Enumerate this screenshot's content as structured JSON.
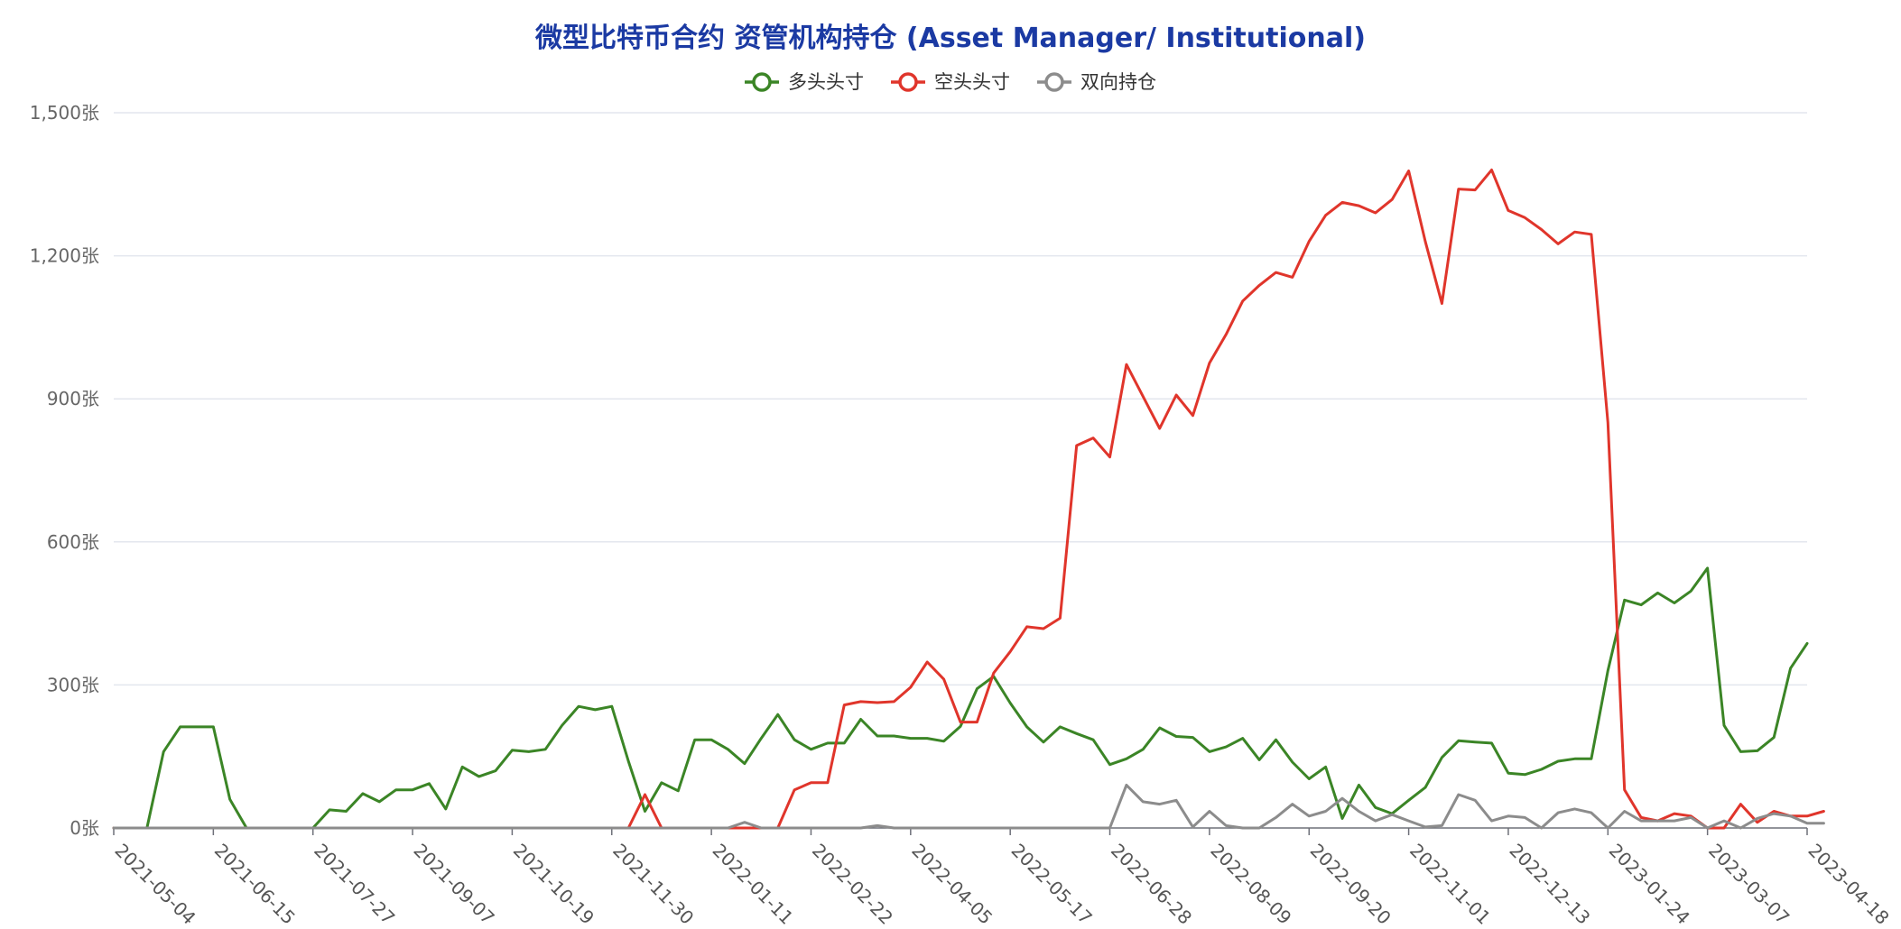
{
  "chart_data": {
    "type": "line",
    "title": "微型比特币合约 资管机构持仓 (Asset Manager/ Institutional)",
    "unit": "张",
    "ylim": [
      0,
      1500
    ],
    "yticks": [
      "0张",
      "300张",
      "600张",
      "900张",
      "1,200张",
      "1,500张"
    ],
    "ytick_values": [
      0,
      300,
      600,
      900,
      1200,
      1500
    ],
    "x_labels": [
      "2021-05-04",
      "2021-06-15",
      "2021-07-27",
      "2021-09-07",
      "2021-10-19",
      "2021-11-30",
      "2022-01-11",
      "2022-02-22",
      "2022-04-05",
      "2022-05-17",
      "2022-06-28",
      "2022-08-09",
      "2022-09-20",
      "2022-11-01",
      "2022-12-13",
      "2023-01-24",
      "2023-03-07",
      "2023-04-18"
    ],
    "x_label_step": 6,
    "grid": true,
    "legend_position": "top-center",
    "series": [
      {
        "name": "多头头寸",
        "color": "#3b8526",
        "values": [
          0,
          0,
          0,
          160,
          212,
          212,
          212,
          60,
          0,
          0,
          0,
          0,
          0,
          38,
          35,
          72,
          55,
          80,
          80,
          93,
          40,
          128,
          108,
          120,
          163,
          160,
          165,
          215,
          255,
          248,
          255,
          140,
          35,
          95,
          78,
          185,
          185,
          165,
          135,
          188,
          238,
          185,
          165,
          178,
          178,
          228,
          193,
          193,
          188,
          188,
          182,
          213,
          292,
          318,
          262,
          212,
          180,
          212,
          198,
          185,
          133,
          145,
          165,
          210,
          192,
          190,
          160,
          170,
          188,
          143,
          185,
          138,
          103,
          128,
          20,
          90,
          43,
          30,
          58,
          85,
          148,
          183,
          180,
          178,
          115,
          112,
          123,
          140,
          145,
          145,
          330,
          478,
          468,
          493,
          472,
          497,
          545,
          215,
          160,
          162,
          190,
          335,
          387
        ]
      },
      {
        "name": "空头头寸",
        "color": "#e0352b",
        "values": [
          0,
          0,
          0,
          0,
          0,
          0,
          0,
          0,
          0,
          0,
          0,
          0,
          0,
          0,
          0,
          0,
          0,
          0,
          0,
          0,
          0,
          0,
          0,
          0,
          0,
          0,
          0,
          0,
          0,
          0,
          0,
          0,
          70,
          0,
          0,
          0,
          0,
          0,
          0,
          0,
          0,
          80,
          95,
          95,
          258,
          265,
          263,
          265,
          295,
          348,
          312,
          222,
          222,
          325,
          370,
          422,
          418,
          440,
          802,
          818,
          778,
          972,
          905,
          838,
          908,
          865,
          975,
          1035,
          1105,
          1138,
          1165,
          1155,
          1230,
          1285,
          1312,
          1305,
          1290,
          1318,
          1378,
          1230,
          1100,
          1340,
          1338,
          1380,
          1295,
          1280,
          1255,
          1225,
          1250,
          1245,
          850,
          80,
          22,
          15,
          30,
          25,
          0,
          0,
          50,
          12,
          35,
          25,
          25,
          35
        ]
      },
      {
        "name": "双向持仓",
        "color": "#8c8c8c",
        "values": [
          0,
          0,
          0,
          0,
          0,
          0,
          0,
          0,
          0,
          0,
          0,
          0,
          0,
          0,
          0,
          0,
          0,
          0,
          0,
          0,
          0,
          0,
          0,
          0,
          0,
          0,
          0,
          0,
          0,
          0,
          0,
          0,
          0,
          0,
          0,
          0,
          0,
          0,
          12,
          0,
          0,
          0,
          0,
          0,
          0,
          0,
          5,
          0,
          0,
          0,
          0,
          0,
          0,
          0,
          0,
          0,
          0,
          0,
          0,
          0,
          0,
          90,
          55,
          50,
          58,
          2,
          35,
          5,
          0,
          0,
          22,
          50,
          25,
          35,
          62,
          35,
          15,
          28,
          15,
          2,
          5,
          70,
          58,
          15,
          25,
          22,
          0,
          32,
          40,
          32,
          0,
          35,
          15,
          15,
          15,
          22,
          0,
          15,
          0,
          20,
          30,
          25,
          10,
          10
        ]
      }
    ]
  }
}
